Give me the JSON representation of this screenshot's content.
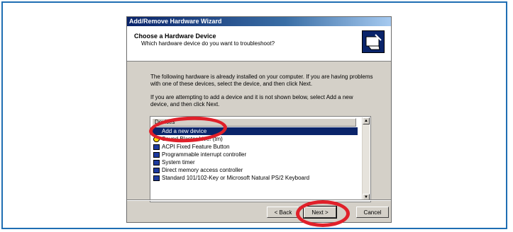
{
  "window": {
    "title": "Add/Remove Hardware Wizard"
  },
  "header": {
    "title": "Choose a Hardware Device",
    "subtitle": "Which hardware device do you want to troubleshoot?",
    "icon": "hardware-wizard-icon"
  },
  "body": {
    "paragraph1_line1": "The following hardware is already installed on your computer. If you are having problems",
    "paragraph1_line2": "with one of these devices, select the device, and then click Next.",
    "paragraph2_line1": "If you are attempting to add a device and it is not shown below, select Add a new",
    "paragraph2_line2": "device, and then click Next."
  },
  "list": {
    "header": "Devices",
    "items": [
      {
        "label": "Add a new device",
        "selected": true,
        "icon": "none"
      },
      {
        "label": "Sound Blaster Live! (tm)",
        "selected": false,
        "icon": "warning-icon"
      },
      {
        "label": "ACPI Fixed Feature Button",
        "selected": false,
        "icon": "device-icon"
      },
      {
        "label": "Programmable interrupt controller",
        "selected": false,
        "icon": "device-icon"
      },
      {
        "label": "System timer",
        "selected": false,
        "icon": "device-icon"
      },
      {
        "label": "Direct memory access controller",
        "selected": false,
        "icon": "device-icon"
      },
      {
        "label": "Standard 101/102-Key or Microsoft Natural PS/2 Keyboard",
        "selected": false,
        "icon": "keyboard-icon"
      }
    ]
  },
  "buttons": {
    "back": "< Back",
    "next": "Next >",
    "cancel": "Cancel"
  },
  "colors": {
    "frame": "#1f6eb3",
    "highlight_circle": "#e0202a",
    "selection": "#0a246a"
  }
}
